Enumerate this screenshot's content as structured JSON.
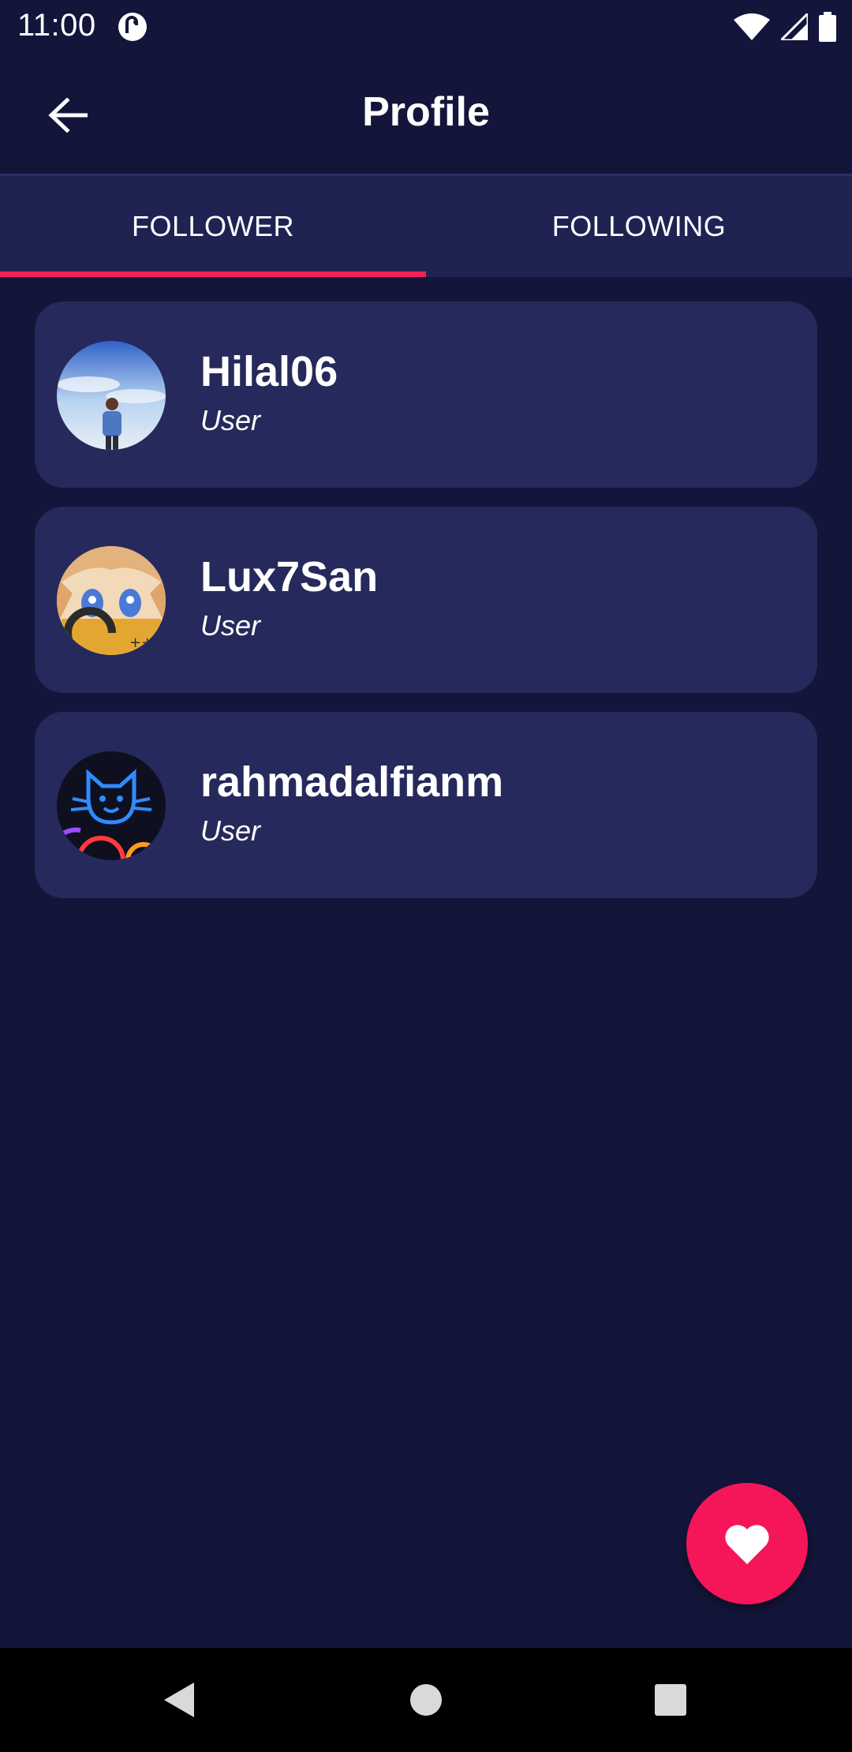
{
  "status_bar": {
    "time": "11:00",
    "icons": [
      "app-notification-icon",
      "wifi-icon",
      "signal-icon",
      "battery-icon"
    ]
  },
  "header": {
    "title": "Profile",
    "back_icon": "arrow-left-icon"
  },
  "tabs": [
    {
      "label": "FOLLOWER",
      "selected": true
    },
    {
      "label": "FOLLOWING",
      "selected": false
    }
  ],
  "followers": [
    {
      "name": "Hilal06",
      "role": "User",
      "avatar": "avatar-photo-sky"
    },
    {
      "name": "Lux7San",
      "role": "User",
      "avatar": "avatar-anime-girl"
    },
    {
      "name": "rahmadalfianm",
      "role": "User",
      "avatar": "avatar-neon-cat"
    }
  ],
  "fab": {
    "icon": "heart-icon"
  },
  "colors": {
    "background": "#13163a",
    "card": "#26295b",
    "tab_bar": "#1f2352",
    "accent": "#f5205a"
  },
  "nav_bar": {
    "icons": [
      "back-triangle-icon",
      "home-circle-icon",
      "recents-square-icon"
    ]
  }
}
